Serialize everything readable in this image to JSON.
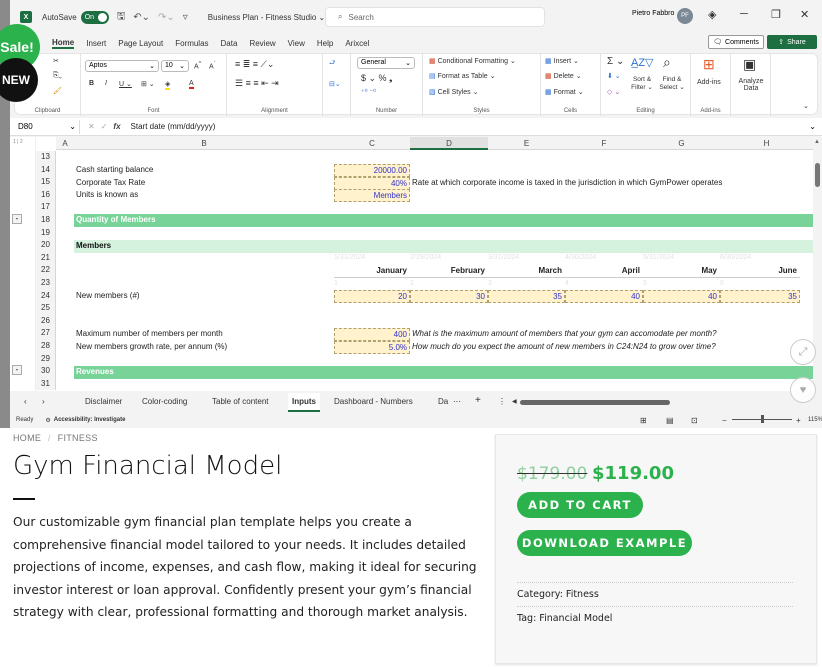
{
  "excel": {
    "titlebar": {
      "autosave_label": "AutoSave",
      "autosave_state": "On",
      "document_title": "Business Plan - Fitness Studio ⌄",
      "search_placeholder": "Search",
      "user_name": "Pietro Fabbro",
      "user_initials": "PF"
    },
    "menu": [
      "Home",
      "Insert",
      "Page Layout",
      "Formulas",
      "Data",
      "Review",
      "View",
      "Help",
      "Arixcel"
    ],
    "comments_label": "Comments",
    "share_label": "Share",
    "ribbon": {
      "clipboard_label": "Clipboard",
      "font_name": "Aptos",
      "font_size": "10",
      "font_label": "Font",
      "alignment_label": "Alignment",
      "number_format": "General",
      "number_label": "Number",
      "conditional_formatting": "Conditional Formatting ⌄",
      "format_as_table": "Format as Table ⌄",
      "cell_styles": "Cell Styles ⌄",
      "styles_label": "Styles",
      "insert": "Insert",
      "delete": "Delete",
      "format": "Format ⌄",
      "cells_label": "Cells",
      "sort_filter": "Sort & Filter ⌄",
      "find_select": "Find & Select ⌄",
      "editing_label": "Editing",
      "addins": "Add-ins",
      "addins_label": "Add-ins",
      "analyze_data": "Analyze Data"
    },
    "formula_bar": {
      "name_box": "D80",
      "formula": "Start date (mm/dd/yyyy)"
    },
    "columns": [
      "A",
      "B",
      "C",
      "D",
      "E",
      "F",
      "G",
      "H"
    ],
    "rows": [
      "13",
      "14",
      "15",
      "16",
      "17",
      "18",
      "19",
      "20",
      "21",
      "22",
      "23",
      "24",
      "25",
      "26",
      "27",
      "28",
      "29",
      "30",
      "31"
    ],
    "cells": {
      "r14_label": "Cash starting balance",
      "r14_value": "20000.00",
      "r15_label": "Corporate Tax Rate",
      "r15_value": "40%",
      "r15_note": "Rate at which corporate income is taxed in the jurisdiction in which GymPower operates",
      "r16_label": "Units is known as",
      "r16_value": "Members",
      "r18_section": "Quantity of Members",
      "r20_subsection": "Members",
      "r21_dates": [
        "1/31/2024",
        "2/29/2024",
        "3/31/2024",
        "4/30/2024",
        "5/31/2024",
        "6/30/2024"
      ],
      "r22_months": [
        "January",
        "February",
        "March",
        "April",
        "May",
        "June"
      ],
      "r23_index": [
        "1",
        "2",
        "3",
        "4",
        "5",
        "6"
      ],
      "r24_label": "New members (#)",
      "r24_values": [
        "20",
        "30",
        "35",
        "40",
        "40",
        "35"
      ],
      "r27_label": "Maximum number of members per month",
      "r27_value": "400",
      "r27_note": "What is the maximum amount of members that your gym can accomodate per month?",
      "r28_label": "New members growth rate, per annum (%)",
      "r28_value": "5.0%",
      "r28_note": "How much do you expect the amount of new members in C24:N24 to grow over time?",
      "r30_section": "Revenues"
    },
    "sheet_tabs": [
      "Disclaimer",
      "Color-coding",
      "Table of content",
      "Inputs",
      "Dashboard - Numbers",
      "Da"
    ],
    "active_tab": "Inputs",
    "status": {
      "ready": "Ready",
      "accessibility": "Accessibility: Investigate",
      "zoom": "115%"
    }
  },
  "badges": {
    "sale": "Sale!",
    "new": "NEW"
  },
  "product": {
    "breadcrumb": [
      "HOME",
      "FITNESS"
    ],
    "breadcrumb_sep": "/",
    "title": "Gym Financial Model",
    "description": "Our customizable gym financial plan template helps you create a comprehensive financial model tailored to your needs. It includes detailed projections of income, expenses, and cash flow, making it ideal for securing investor interest or loan approval. Confidently present your gym’s financial strategy with clear, professional formatting and thorough market analysis.",
    "old_price": "$179.00",
    "price": "$119.00",
    "add_to_cart": "ADD TO CART",
    "download_example": "DOWNLOAD EXAMPLE",
    "category": "Category: Fitness",
    "tag": "Tag: Financial Model",
    "accent_color": "#2bb24c"
  }
}
